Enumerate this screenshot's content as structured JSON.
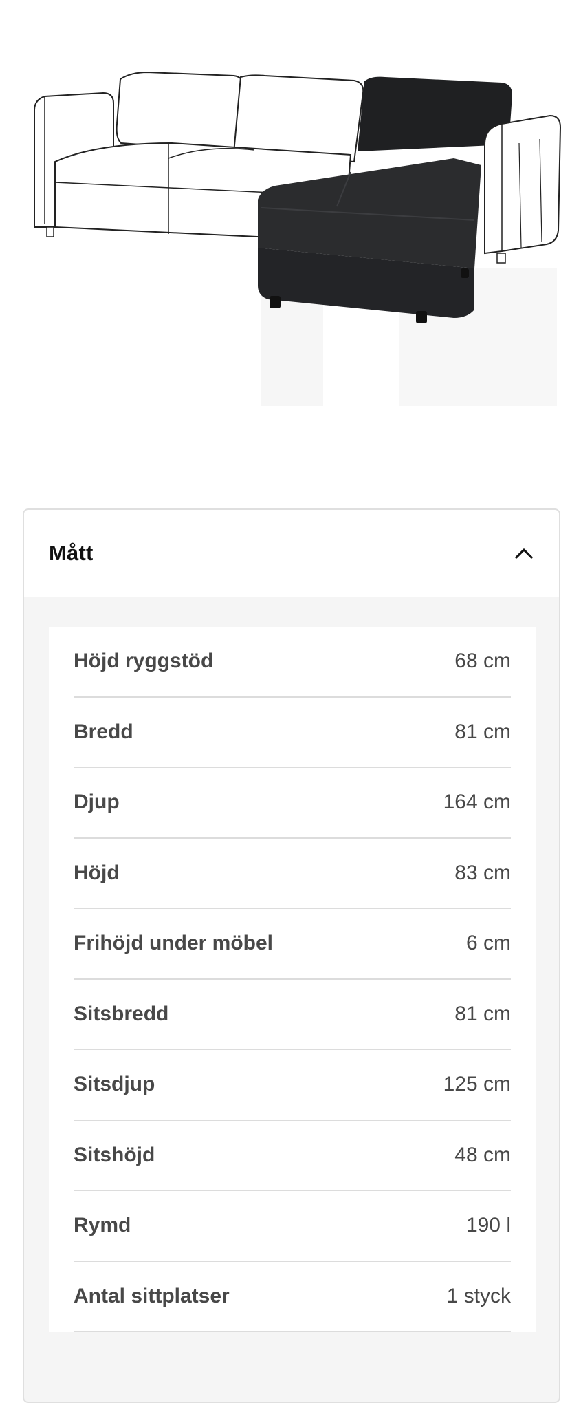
{
  "product_image": {
    "icon": "sofa-chaise-longue-image"
  },
  "dimensions_panel": {
    "title": "Mått",
    "expanded": true,
    "toggle_icon": "chevron-up-icon",
    "rows": [
      {
        "label": "Höjd ryggstöd",
        "value": "68 cm"
      },
      {
        "label": "Bredd",
        "value": "81 cm"
      },
      {
        "label": "Djup",
        "value": "164 cm"
      },
      {
        "label": "Höjd",
        "value": "83 cm"
      },
      {
        "label": "Frihöjd under möbel",
        "value": "6 cm"
      },
      {
        "label": "Sitsbredd",
        "value": "81 cm"
      },
      {
        "label": "Sitsdjup",
        "value": "125 cm"
      },
      {
        "label": "Sitshöjd",
        "value": "48 cm"
      },
      {
        "label": "Rymd",
        "value": "190 l"
      },
      {
        "label": "Antal sittplatser",
        "value": "1 styck"
      }
    ]
  }
}
